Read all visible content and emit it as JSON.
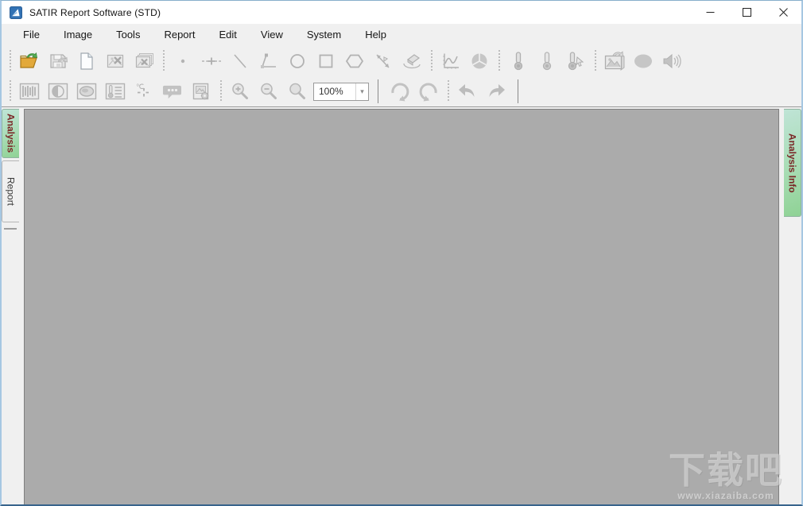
{
  "window": {
    "title": "SATIR Report Software (STD)",
    "controls": [
      "minimize",
      "maximize",
      "close"
    ]
  },
  "menu": {
    "items": [
      {
        "label": "File"
      },
      {
        "label": "Image"
      },
      {
        "label": "Tools"
      },
      {
        "label": "Report"
      },
      {
        "label": "Edit"
      },
      {
        "label": "View"
      },
      {
        "label": "System"
      },
      {
        "label": "Help"
      }
    ]
  },
  "toolbars": {
    "row1": {
      "groups": [
        [
          "open-file",
          "save-file",
          "new-document",
          "close-image",
          "close-all-images"
        ],
        [
          "spot-tool",
          "line-spot-tool",
          "line-tool",
          "angle-tool",
          "ellipse-tool",
          "rectangle-tool",
          "polygon-tool",
          "arrow-measure-tool",
          "eraser-tool"
        ],
        [
          "line-chart",
          "pie-chart"
        ],
        [
          "thermometer-max",
          "thermometer-min",
          "thermometer-cursor"
        ],
        [
          "export-image",
          "shape-fill",
          "audio-annotation"
        ]
      ]
    },
    "row2": {
      "groups": [
        [
          "palette",
          "contrast",
          "isotherm",
          "temperature-list",
          "temperature-cursor",
          "comment",
          "report-settings"
        ],
        [
          "zoom-in",
          "zoom-out",
          "zoom-fit"
        ]
      ],
      "zoom_value": "100%",
      "after_combo": [
        "rotate-cw",
        "rotate-ccw",
        "undo",
        "redo"
      ]
    }
  },
  "left_panel": {
    "tabs": [
      {
        "label": "Analysis",
        "selected": true
      },
      {
        "label": "Report",
        "selected": false
      }
    ]
  },
  "right_panel": {
    "tabs": [
      {
        "label": "Analysis Info",
        "selected": true
      }
    ]
  },
  "watermark": {
    "title": "下载吧",
    "url": "www.xiazaiba.com"
  },
  "colors": {
    "tab_gradient_top": "#bfe4d6",
    "tab_gradient_bottom": "#8fd295",
    "tab_text": "#7a2626",
    "canvas_gray": "#ababab",
    "chrome_gray": "#f0f0f0",
    "window_border": "#a6c7e2",
    "folder_icon_yellow": "#e2a93b",
    "folder_icon_arrow_green": "#55ad55"
  }
}
